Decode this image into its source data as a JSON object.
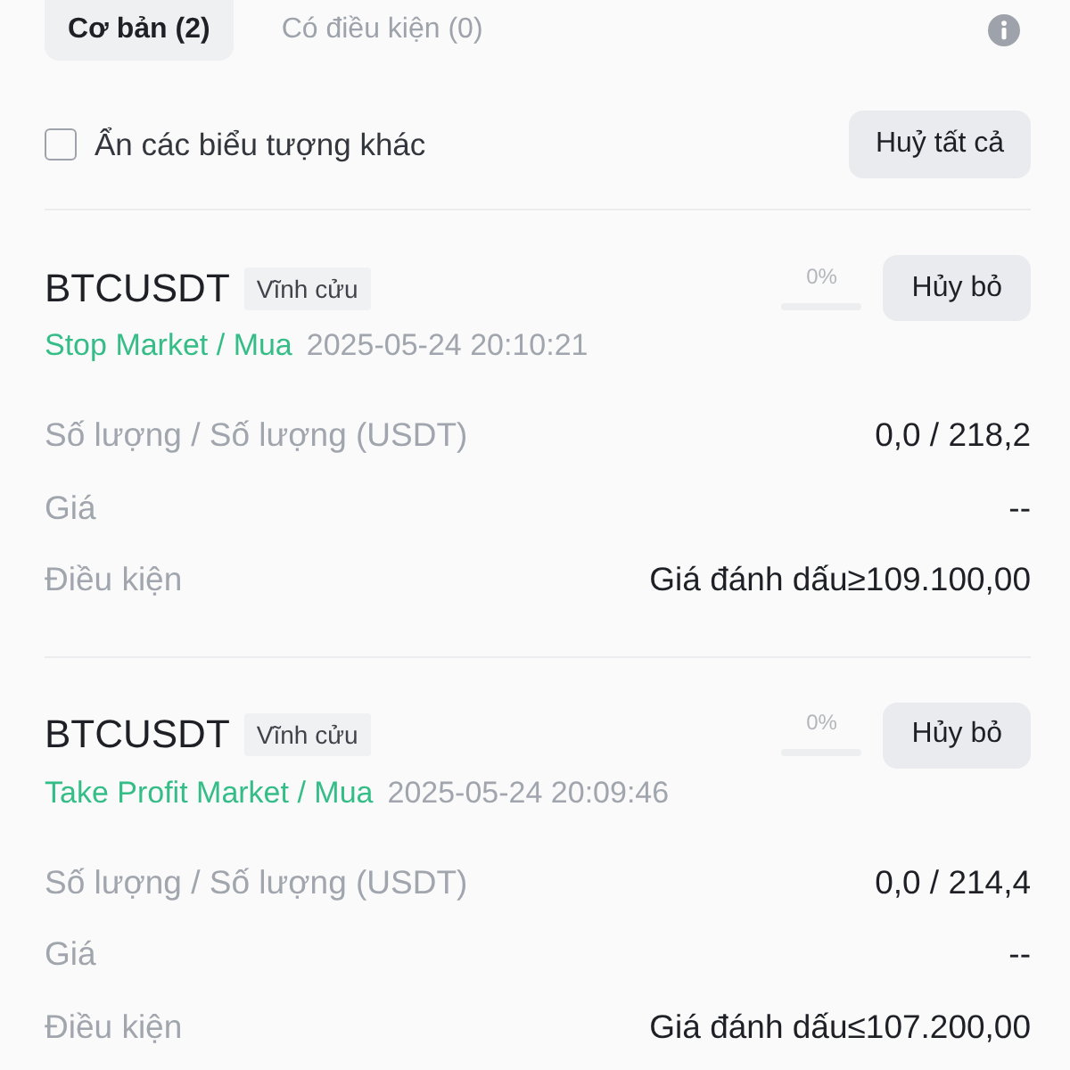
{
  "tabs": [
    {
      "label": "Cơ bản (2)",
      "selected": true
    },
    {
      "label": "Có điều kiện (0)",
      "selected": false
    }
  ],
  "filter": {
    "label": "Ẩn các biểu tượng khác",
    "checked": false
  },
  "cancel_all_button": "Huỷ tất cả",
  "orders": [
    {
      "symbol": "BTCUSDT",
      "tag": "Vĩnh cửu",
      "progress": {
        "reading": "0%",
        "level": 0
      },
      "cancel_button": "Hủy bỏ",
      "type": "Stop Market / Mua",
      "time": "2025-05-24 20:10:21",
      "fields": [
        {
          "label": "Số lượng / Số lượng (USDT)",
          "value": "0,0 / 218,2"
        },
        {
          "label": "Giá",
          "value": "--"
        },
        {
          "label": "Điều kiện",
          "value": "Giá đánh dấu≥109.100,00"
        }
      ]
    },
    {
      "symbol": "BTCUSDT",
      "tag": "Vĩnh cửu",
      "progress": {
        "reading": "0%",
        "level": 0
      },
      "cancel_button": "Hủy bỏ",
      "type": "Take Profit Market / Mua",
      "time": "2025-05-24 20:09:46",
      "fields": [
        {
          "label": "Số lượng / Số lượng (USDT)",
          "value": "0,0 / 214,4"
        },
        {
          "label": "Giá",
          "value": "--"
        },
        {
          "label": "Điều kiện",
          "value": "Giá đánh dấu≤107.200,00"
        }
      ]
    }
  ]
}
